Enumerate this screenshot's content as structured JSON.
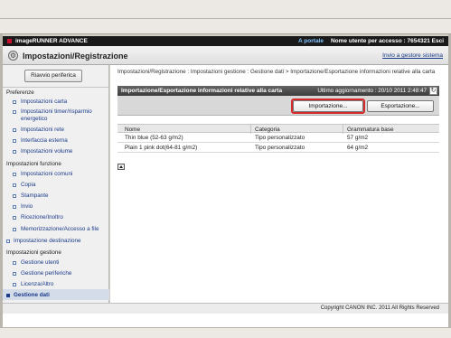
{
  "app": {
    "brand": "imageRUNNER ADVANCE",
    "portal_link": "A portale",
    "user_info": "Nome utente per accesso : 7654321 Esci",
    "page_title": "Impostazioni/Registrazione",
    "send_mail_link": "Invio a gestore sistema"
  },
  "sidebar": {
    "restart_button": "Riavvio periferica",
    "sections": [
      {
        "label": "Preferenze"
      },
      {
        "label": "Impostazioni funzione"
      },
      {
        "label": "Impostazioni gestione"
      }
    ],
    "items": [
      {
        "label": "Impostazioni carta"
      },
      {
        "label": "Impostazioni timer/risparmio energetico"
      },
      {
        "label": "Impostazioni rete"
      },
      {
        "label": "Interfaccia esterna"
      },
      {
        "label": "Impostazioni volume"
      },
      {
        "label": "Impostazioni comuni"
      },
      {
        "label": "Copia"
      },
      {
        "label": "Stampante"
      },
      {
        "label": "Invio"
      },
      {
        "label": "Ricezione/Inoltro"
      },
      {
        "label": "Memorizzazione/Accesso a file"
      },
      {
        "label": "Impostazione destinazione"
      },
      {
        "label": "Gestione utenti"
      },
      {
        "label": "Gestione periferiche"
      },
      {
        "label": "Licenza/Altro"
      },
      {
        "label": "Gestione dati"
      }
    ]
  },
  "main": {
    "breadcrumb": "Impostazioni/Registrazione : Impostazioni gestione : Gestione dati > Importazione/Esportazione informazioni relative alla carta",
    "panel_title": "Importazione/Esportazione informazioni relative alla carta",
    "last_updated": "Ultimo aggiornamento : 20/10 2011 2:48:47",
    "import_button": "Importazione...",
    "export_button": "Esportazione...",
    "table": {
      "headers": [
        "Nome",
        "Categoria",
        "Grammatura base"
      ],
      "rows": [
        [
          "Thin blue (52-63 g/m2)",
          "Tipo personalizzato",
          "57 g/m2"
        ],
        [
          "Plain 1 pink dot(64-81 g/m2)",
          "Tipo personalizzato",
          "64 g/m2"
        ]
      ]
    }
  },
  "footer": {
    "copyright": "Copyright CANON INC. 2011 All Rights Reserved"
  },
  "colors": {
    "highlight_ring": "#d42a2a",
    "portal_link": "#7fc4ff",
    "link": "#1a3a8a"
  }
}
